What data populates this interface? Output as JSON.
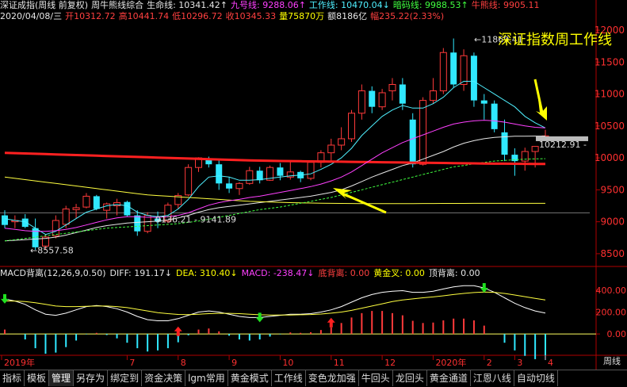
{
  "header": {
    "line1": [
      {
        "text": "深证成指(周线 前复权)",
        "cls": "w",
        "name": "instrument-title"
      },
      {
        "text": "周牛熊线综合",
        "cls": "w",
        "name": "indicator-name"
      },
      {
        "text": "生命线: 10341.42↑",
        "cls": "w",
        "name": "lifeline-value"
      },
      {
        "text": "九号线: 9288.06↑",
        "cls": "m",
        "name": "ninth-line-value"
      },
      {
        "text": "工作线: 10470.04↓",
        "cls": "c",
        "name": "work-line-value"
      },
      {
        "text": "暗码线: 9988.53↑",
        "cls": "g",
        "name": "dark-line-value"
      },
      {
        "text": "牛熊线: 9905.11",
        "cls": "r",
        "name": "bull-bear-line-value"
      }
    ],
    "line2": [
      {
        "text": "2020/04/08/三",
        "cls": "w",
        "name": "date-label"
      },
      {
        "text": "开10312.72",
        "cls": "r",
        "name": "open-value"
      },
      {
        "text": "高10441.74",
        "cls": "r",
        "name": "high-value"
      },
      {
        "text": "低10296.72",
        "cls": "r",
        "name": "low-value"
      },
      {
        "text": "收10345.33",
        "cls": "r",
        "name": "close-value"
      },
      {
        "text": "量75870万",
        "cls": "y",
        "name": "volume-value"
      },
      {
        "text": "额8186亿",
        "cls": "w",
        "name": "amount-value"
      },
      {
        "text": "幅235.22(2.33%)",
        "cls": "r",
        "name": "change-value"
      }
    ]
  },
  "annotation": "深证指数周工作线",
  "price_labels": {
    "high": "11869.41",
    "low": "8557.58",
    "mid": "9136.21 - 9141.89",
    "last": "10212.91 -"
  },
  "macd_header": [
    {
      "text": "MACD背离(12,26,9,0.50)",
      "cls": "w",
      "name": "macd-title"
    },
    {
      "text": "DIFF: 191.17↓",
      "cls": "w",
      "name": "diff-value"
    },
    {
      "text": "DEA: 310.40↓",
      "cls": "y",
      "name": "dea-value"
    },
    {
      "text": "MACD: -238.47↓",
      "cls": "m",
      "name": "macd-value"
    },
    {
      "text": "底背离: 0.00",
      "cls": "r",
      "name": "bottom-divergence-value"
    },
    {
      "text": "黄金叉: 0.00",
      "cls": "y",
      "name": "golden-cross-value"
    },
    {
      "text": "顶背离: 0.00",
      "cls": "w",
      "name": "top-divergence-value"
    }
  ],
  "x_axis": [
    "2019年",
    "7",
    "8",
    "9",
    "10",
    "11",
    "12",
    "2020年",
    "2",
    "3",
    "4"
  ],
  "period_label": "周线",
  "tabs": [
    "指标",
    "模板",
    "管理",
    "另存为",
    "绑定到",
    "资金决策",
    "lgm常用",
    "黄金模式",
    "工作线",
    "变色龙加强",
    "牛回头",
    "龙回头",
    "黄金通道",
    "江恩八线",
    "自动切线"
  ],
  "active_tab": "管理",
  "chart_data": {
    "type": "candlestick",
    "price_axis": {
      "ticks": [
        8500,
        9000,
        9500,
        10000,
        10500,
        11000,
        11500,
        12000
      ],
      "ylim": [
        8300,
        12100
      ]
    },
    "macd_axis": {
      "ticks": [
        400,
        200,
        0
      ],
      "labels": [
        "400.00",
        "200.00",
        "0.00"
      ],
      "ylim": [
        -180,
        500
      ]
    },
    "candles": [
      {
        "o": 9100,
        "h": 9180,
        "l": 8900,
        "c": 8950
      },
      {
        "o": 9000,
        "h": 9100,
        "l": 8900,
        "c": 9020
      },
      {
        "o": 9050,
        "h": 9120,
        "l": 8900,
        "c": 8920
      },
      {
        "o": 8900,
        "h": 9050,
        "l": 8560,
        "c": 8600
      },
      {
        "o": 8620,
        "h": 8800,
        "l": 8560,
        "c": 8760
      },
      {
        "o": 8780,
        "h": 9100,
        "l": 8740,
        "c": 9020
      },
      {
        "o": 8960,
        "h": 9250,
        "l": 8900,
        "c": 9200
      },
      {
        "o": 9190,
        "h": 9280,
        "l": 9050,
        "c": 9220
      },
      {
        "o": 9230,
        "h": 9450,
        "l": 9210,
        "c": 9400
      },
      {
        "o": 9400,
        "h": 9420,
        "l": 9180,
        "c": 9200
      },
      {
        "o": 9180,
        "h": 9300,
        "l": 9050,
        "c": 9280
      },
      {
        "o": 9250,
        "h": 9360,
        "l": 9100,
        "c": 9300
      },
      {
        "o": 9310,
        "h": 9330,
        "l": 9080,
        "c": 9100
      },
      {
        "o": 9100,
        "h": 9180,
        "l": 8780,
        "c": 8850
      },
      {
        "o": 8850,
        "h": 9150,
        "l": 8820,
        "c": 9100
      },
      {
        "o": 9050,
        "h": 9160,
        "l": 8900,
        "c": 9000
      },
      {
        "o": 9010,
        "h": 9300,
        "l": 8980,
        "c": 9260
      },
      {
        "o": 9270,
        "h": 9450,
        "l": 9200,
        "c": 9410
      },
      {
        "o": 9420,
        "h": 9900,
        "l": 9400,
        "c": 9850
      },
      {
        "o": 9850,
        "h": 10010,
        "l": 9780,
        "c": 10000
      },
      {
        "o": 9990,
        "h": 10020,
        "l": 9850,
        "c": 9900
      },
      {
        "o": 9900,
        "h": 9960,
        "l": 9500,
        "c": 9600
      },
      {
        "o": 9600,
        "h": 9700,
        "l": 9450,
        "c": 9520
      },
      {
        "o": 9520,
        "h": 9620,
        "l": 9420,
        "c": 9600
      },
      {
        "o": 9600,
        "h": 9860,
        "l": 9580,
        "c": 9800
      },
      {
        "o": 9800,
        "h": 9860,
        "l": 9600,
        "c": 9650
      },
      {
        "o": 9650,
        "h": 9880,
        "l": 9640,
        "c": 9850
      },
      {
        "o": 9850,
        "h": 9920,
        "l": 9650,
        "c": 9720
      },
      {
        "o": 9700,
        "h": 9950,
        "l": 9660,
        "c": 9780
      },
      {
        "o": 9780,
        "h": 9800,
        "l": 9620,
        "c": 9680
      },
      {
        "o": 9680,
        "h": 9960,
        "l": 9650,
        "c": 9930
      },
      {
        "o": 9930,
        "h": 10120,
        "l": 9850,
        "c": 10080
      },
      {
        "o": 10080,
        "h": 10300,
        "l": 9950,
        "c": 10200
      },
      {
        "o": 10200,
        "h": 10480,
        "l": 10120,
        "c": 10300
      },
      {
        "o": 10300,
        "h": 10750,
        "l": 10250,
        "c": 10700
      },
      {
        "o": 10700,
        "h": 11150,
        "l": 10600,
        "c": 11050
      },
      {
        "o": 11050,
        "h": 11120,
        "l": 10700,
        "c": 10800
      },
      {
        "o": 10800,
        "h": 11080,
        "l": 10750,
        "c": 11020
      },
      {
        "o": 11050,
        "h": 11250,
        "l": 10900,
        "c": 11150
      },
      {
        "o": 11150,
        "h": 11250,
        "l": 10750,
        "c": 10850
      },
      {
        "o": 10600,
        "h": 10700,
        "l": 9850,
        "c": 9900
      },
      {
        "o": 9900,
        "h": 10950,
        "l": 9880,
        "c": 10900
      },
      {
        "o": 10900,
        "h": 11250,
        "l": 10850,
        "c": 11050
      },
      {
        "o": 11050,
        "h": 11720,
        "l": 11000,
        "c": 11650
      },
      {
        "o": 11650,
        "h": 11870,
        "l": 11100,
        "c": 11150
      },
      {
        "o": 11150,
        "h": 11700,
        "l": 11050,
        "c": 11600
      },
      {
        "o": 11600,
        "h": 11650,
        "l": 10800,
        "c": 10900
      },
      {
        "o": 10900,
        "h": 11000,
        "l": 10600,
        "c": 10850
      },
      {
        "o": 10850,
        "h": 10900,
        "l": 10400,
        "c": 10450
      },
      {
        "o": 10400,
        "h": 10600,
        "l": 9950,
        "c": 10050
      },
      {
        "o": 10050,
        "h": 10150,
        "l": 9720,
        "c": 9950
      },
      {
        "o": 9950,
        "h": 10160,
        "l": 9800,
        "c": 10100
      },
      {
        "o": 10100,
        "h": 10170,
        "l": 9850,
        "c": 10180
      },
      {
        "o": 10310,
        "h": 10440,
        "l": 10290,
        "c": 10345
      }
    ],
    "series": [
      {
        "name": "生命线",
        "color": "#e6e6e6",
        "values": [
          8700,
          8710,
          8720,
          8730,
          8740,
          8760,
          8790,
          8830,
          8870,
          8910,
          8940,
          8960,
          8980,
          8990,
          9000,
          9010,
          9030,
          9060,
          9100,
          9150,
          9190,
          9220,
          9240,
          9260,
          9280,
          9300,
          9320,
          9340,
          9360,
          9380,
          9400,
          9430,
          9460,
          9500,
          9560,
          9630,
          9700,
          9760,
          9820,
          9880,
          9920,
          9980,
          10040,
          10100,
          10170,
          10230,
          10270,
          10300,
          10320,
          10330,
          10340,
          10340,
          10342,
          10341
        ]
      },
      {
        "name": "九号线",
        "color": "#ffff40",
        "values": [
          9700,
          9680,
          9660,
          9640,
          9620,
          9600,
          9580,
          9560,
          9540,
          9520,
          9500,
          9480,
          9460,
          9440,
          9420,
          9410,
          9400,
          9390,
          9380,
          9370,
          9360,
          9350,
          9340,
          9330,
          9320,
          9315,
          9310,
          9305,
          9300,
          9296,
          9293,
          9290,
          9288,
          9287,
          9286,
          9285,
          9284,
          9284,
          9284,
          9285,
          9285,
          9286,
          9286,
          9287,
          9287,
          9287,
          9288,
          9288,
          9288,
          9288,
          9288,
          9288,
          9288,
          9288
        ]
      },
      {
        "name": "工作线",
        "color": "#4ff0ff",
        "values": [
          9050,
          9020,
          9000,
          8900,
          8800,
          8850,
          8950,
          9050,
          9150,
          9200,
          9250,
          9270,
          9250,
          9150,
          9100,
          9080,
          9100,
          9200,
          9350,
          9550,
          9700,
          9720,
          9700,
          9650,
          9650,
          9660,
          9680,
          9700,
          9720,
          9730,
          9750,
          9820,
          9900,
          10000,
          10150,
          10350,
          10500,
          10650,
          10750,
          10820,
          10780,
          10780,
          10850,
          10950,
          11100,
          11200,
          11200,
          11100,
          11000,
          10900,
          10800,
          10650,
          10550,
          10470
        ]
      },
      {
        "name": "暗码线",
        "color": "#40ff40",
        "values": [
          8700,
          8720,
          8740,
          8760,
          8780,
          8800,
          8820,
          8840,
          8860,
          8880,
          8900,
          8910,
          8920,
          8930,
          8940,
          8950,
          8960,
          8970,
          8990,
          9010,
          9040,
          9070,
          9100,
          9130,
          9160,
          9190,
          9210,
          9230,
          9260,
          9290,
          9320,
          9350,
          9380,
          9420,
          9460,
          9500,
          9540,
          9580,
          9620,
          9660,
          9700,
          9740,
          9780,
          9820,
          9860,
          9880,
          9910,
          9930,
          9950,
          9960,
          9970,
          9980,
          9985,
          9988
        ]
      },
      {
        "name": "牛熊线",
        "color": "#ff2020",
        "values": [
          10080,
          10075,
          10070,
          10065,
          10060,
          10055,
          10050,
          10045,
          10040,
          10035,
          10030,
          10025,
          10020,
          10015,
          10010,
          10005,
          10000,
          9995,
          9990,
          9985,
          9980,
          9975,
          9970,
          9965,
          9960,
          9958,
          9955,
          9952,
          9950,
          9948,
          9946,
          9944,
          9942,
          9940,
          9938,
          9936,
          9934,
          9932,
          9930,
          9928,
          9926,
          9924,
          9922,
          9920,
          9918,
          9916,
          9914,
          9912,
          9910,
          9909,
          9908,
          9907,
          9906,
          9905
        ]
      },
      {
        "name": "均线",
        "color": "#ff40ff",
        "values": [
          8900,
          8880,
          8860,
          8850,
          8850,
          8860,
          8880,
          8910,
          8950,
          8990,
          9030,
          9060,
          9080,
          9080,
          9070,
          9070,
          9080,
          9100,
          9140,
          9200,
          9260,
          9300,
          9330,
          9350,
          9380,
          9400,
          9430,
          9460,
          9490,
          9520,
          9550,
          9590,
          9640,
          9700,
          9780,
          9880,
          9980,
          10080,
          10160,
          10240,
          10300,
          10360,
          10420,
          10480,
          10530,
          10560,
          10580,
          10590,
          10580,
          10560,
          10530,
          10500,
          10480,
          10470
        ]
      }
    ],
    "macd": {
      "diff": [
        320,
        300,
        270,
        220,
        180,
        170,
        190,
        220,
        250,
        260,
        250,
        230,
        200,
        160,
        130,
        120,
        120,
        140,
        170,
        200,
        210,
        200,
        180,
        160,
        150,
        150,
        160,
        170,
        180,
        180,
        185,
        200,
        220,
        250,
        290,
        330,
        360,
        380,
        390,
        395,
        380,
        380,
        390,
        410,
        430,
        440,
        440,
        420,
        380,
        330,
        280,
        240,
        210,
        191
      ],
      "dea": [
        300,
        300,
        295,
        285,
        270,
        255,
        250,
        250,
        252,
        255,
        255,
        250,
        240,
        225,
        210,
        195,
        185,
        178,
        176,
        180,
        185,
        188,
        188,
        185,
        180,
        175,
        172,
        172,
        173,
        175,
        177,
        182,
        190,
        200,
        215,
        235,
        255,
        275,
        295,
        310,
        320,
        330,
        338,
        348,
        360,
        370,
        378,
        382,
        380,
        370,
        355,
        340,
        325,
        310
      ],
      "hist": [
        40,
        0,
        -50,
        -130,
        -180,
        -170,
        -120,
        -60,
        -4,
        10,
        -10,
        -40,
        -80,
        -130,
        -160,
        -150,
        -130,
        -76,
        -12,
        40,
        50,
        24,
        -16,
        -50,
        -60,
        -50,
        -24,
        -4,
        14,
        10,
        16,
        36,
        60,
        100,
        150,
        190,
        210,
        210,
        190,
        170,
        120,
        100,
        104,
        124,
        140,
        140,
        124,
        76,
        0,
        -80,
        -150,
        -200,
        -230,
        -238
      ],
      "golden_cross_arrows": [
        17,
        32
      ],
      "death_cross_arrows": [
        0,
        25,
        47
      ]
    },
    "hline_price": 9140
  }
}
